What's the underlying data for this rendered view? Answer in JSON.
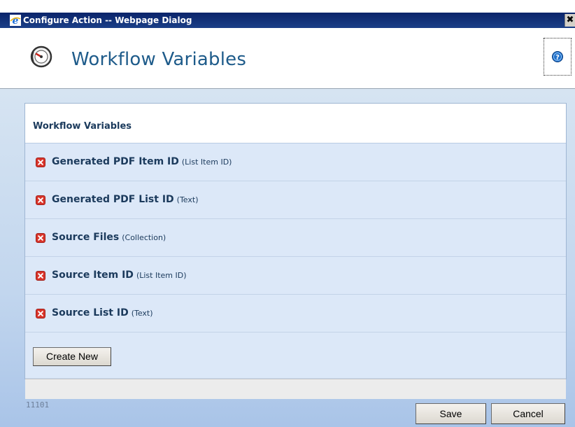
{
  "window": {
    "title": "Configure Action -- Webpage Dialog",
    "close_glyph": "✖",
    "title_icon": "ie-icon"
  },
  "header": {
    "title": "Workflow Variables",
    "logo_icon": "dial-icon",
    "help_icon": "help-icon"
  },
  "panel": {
    "heading": "Workflow Variables",
    "delete_icon": "delete-icon",
    "variables": [
      {
        "name": "Generated PDF Item ID",
        "type": "(List Item ID)"
      },
      {
        "name": "Generated PDF List ID",
        "type": "(Text)"
      },
      {
        "name": "Source Files",
        "type": "(Collection)"
      },
      {
        "name": "Source Item ID",
        "type": "(List Item ID)"
      },
      {
        "name": "Source List ID",
        "type": "(Text)"
      }
    ],
    "create_button": "Create New"
  },
  "footer": {
    "code": "11101",
    "save_label": "Save",
    "cancel_label": "Cancel"
  },
  "colors": {
    "title_bar": "#0a246a",
    "heading_text": "#1e5b8a",
    "delete_red": "#d9352b",
    "panel_bg": "#dce8f8"
  }
}
